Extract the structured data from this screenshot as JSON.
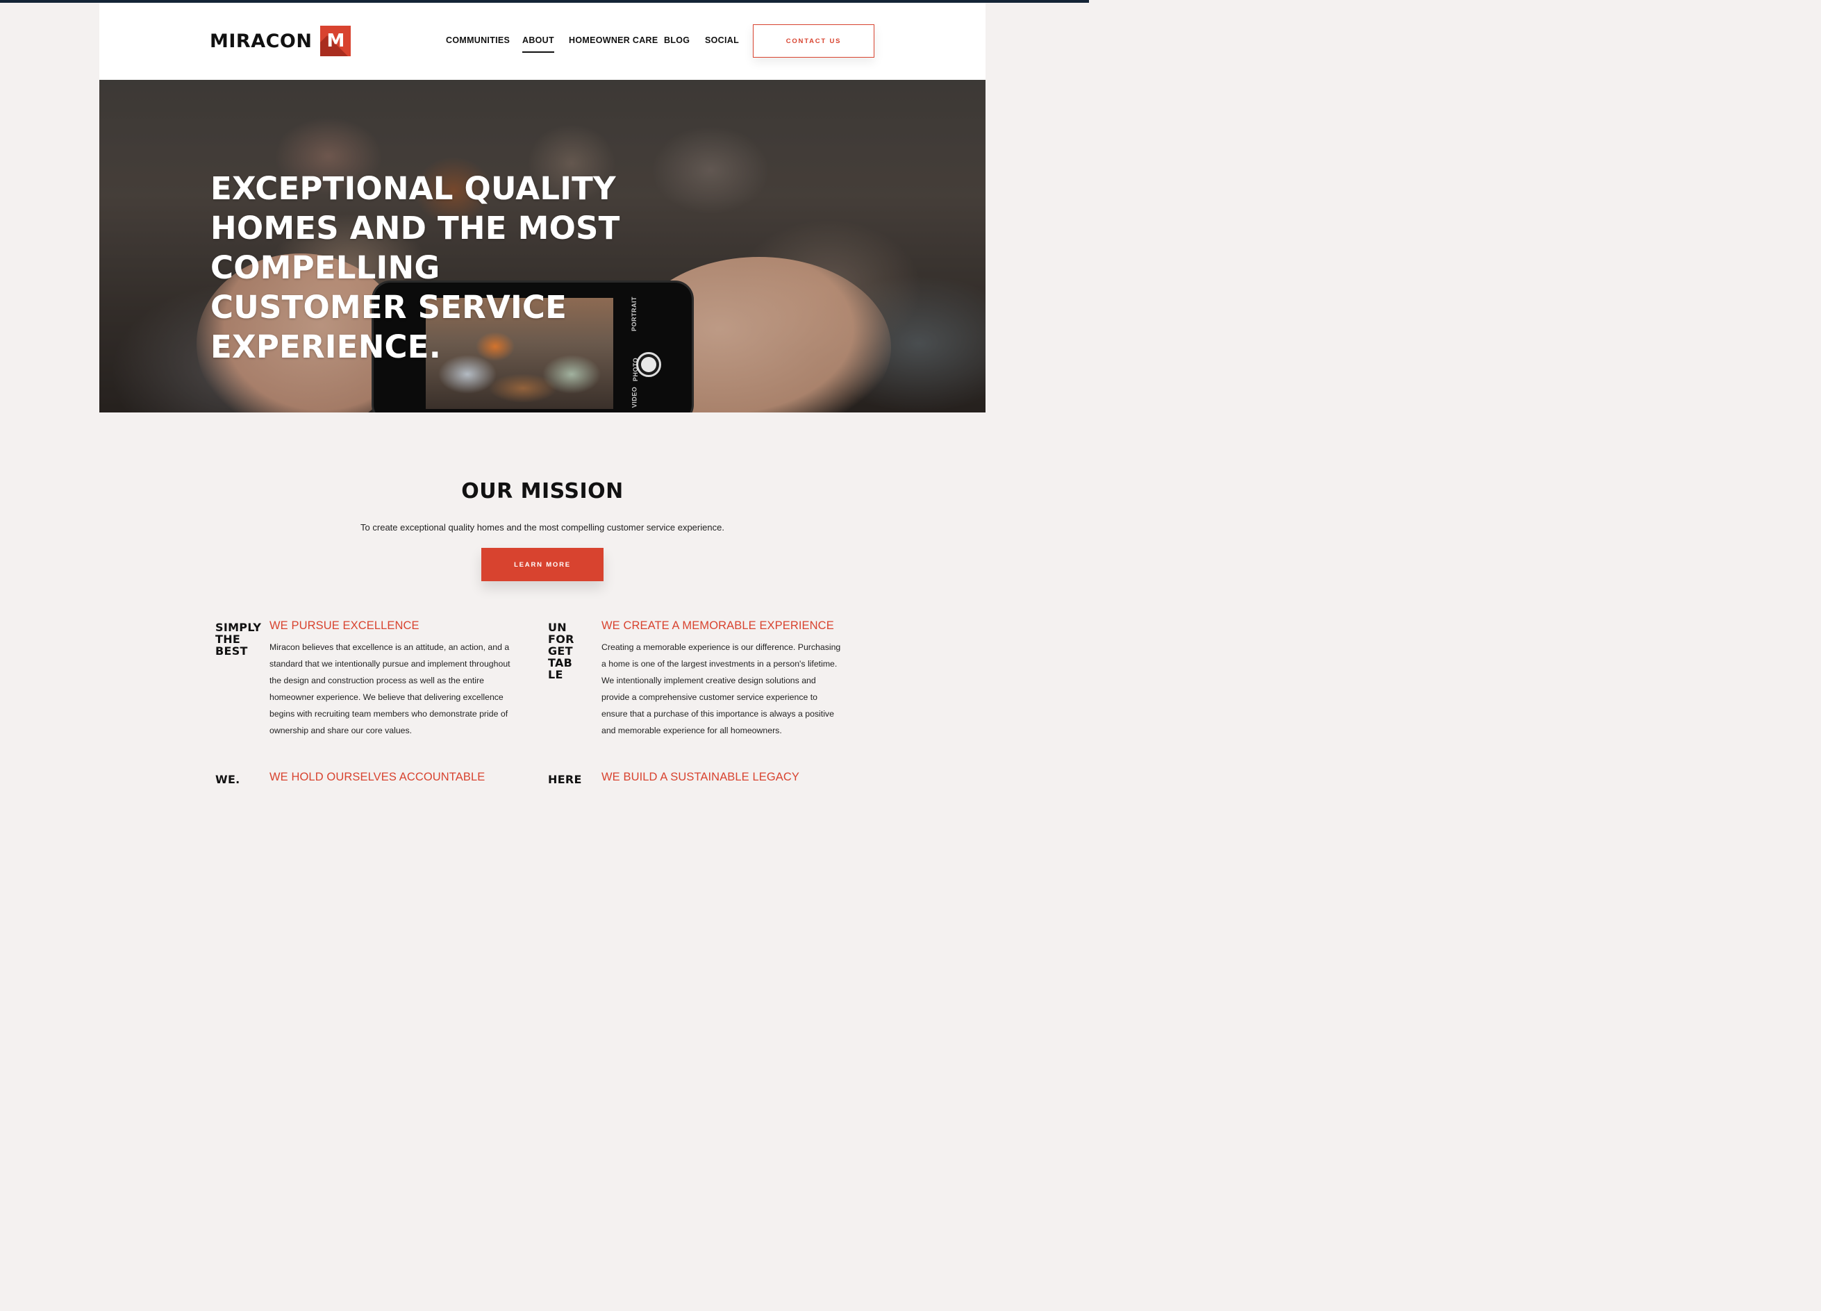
{
  "brand": {
    "name": "MIRACON",
    "mark_letter": "M",
    "accent_color": "#d8432f",
    "topbar_color": "#142436"
  },
  "nav": {
    "items": [
      {
        "label": "COMMUNITIES",
        "active": false
      },
      {
        "label": "ABOUT",
        "active": true
      },
      {
        "label": "HOMEOWNER CARE",
        "active": false
      },
      {
        "label": "BLOG",
        "active": false
      },
      {
        "label": "SOCIAL",
        "active": false
      }
    ],
    "contact_label": "CONTACT US"
  },
  "hero": {
    "title": "EXCEPTIONAL QUALITY HOMES AND THE MOST COMPELLING CUSTOMER SERVICE EXPERIENCE.",
    "phone_modes": [
      "PORTRAIT",
      "PHOTO",
      "VIDEO"
    ]
  },
  "mission": {
    "title": "OUR MISSION",
    "text": "To create exceptional quality homes and the most compelling customer service experience.",
    "button_label": "LEARN MORE"
  },
  "values": [
    {
      "tag": "SIMPLY\nTHE\nBEST",
      "heading": "WE PURSUE EXCELLENCE",
      "body": "Miracon believes that excellence is an attitude, an action, and a standard that we intentionally pursue and implement throughout the design and construction process as well as the entire homeowner experience. We believe that delivering excellence begins with recruiting team members who demonstrate pride of ownership and share our core values."
    },
    {
      "tag": "UN\nFOR\nGET\nTAB\nLE",
      "heading": "WE CREATE A MEMORABLE EXPERIENCE",
      "body": "Creating a memorable experience is our difference. Purchasing a home is one of the largest investments in a person's lifetime. We intentionally implement creative design solutions and provide a comprehensive customer service experience to ensure that a purchase of this importance is always a positive and memorable experience for all homeowners."
    },
    {
      "tag": "WE.",
      "heading": "WE HOLD OURSELVES ACCOUNTABLE",
      "body": ""
    },
    {
      "tag": "HERE",
      "heading": "WE BUILD A SUSTAINABLE LEGACY",
      "body": ""
    }
  ]
}
